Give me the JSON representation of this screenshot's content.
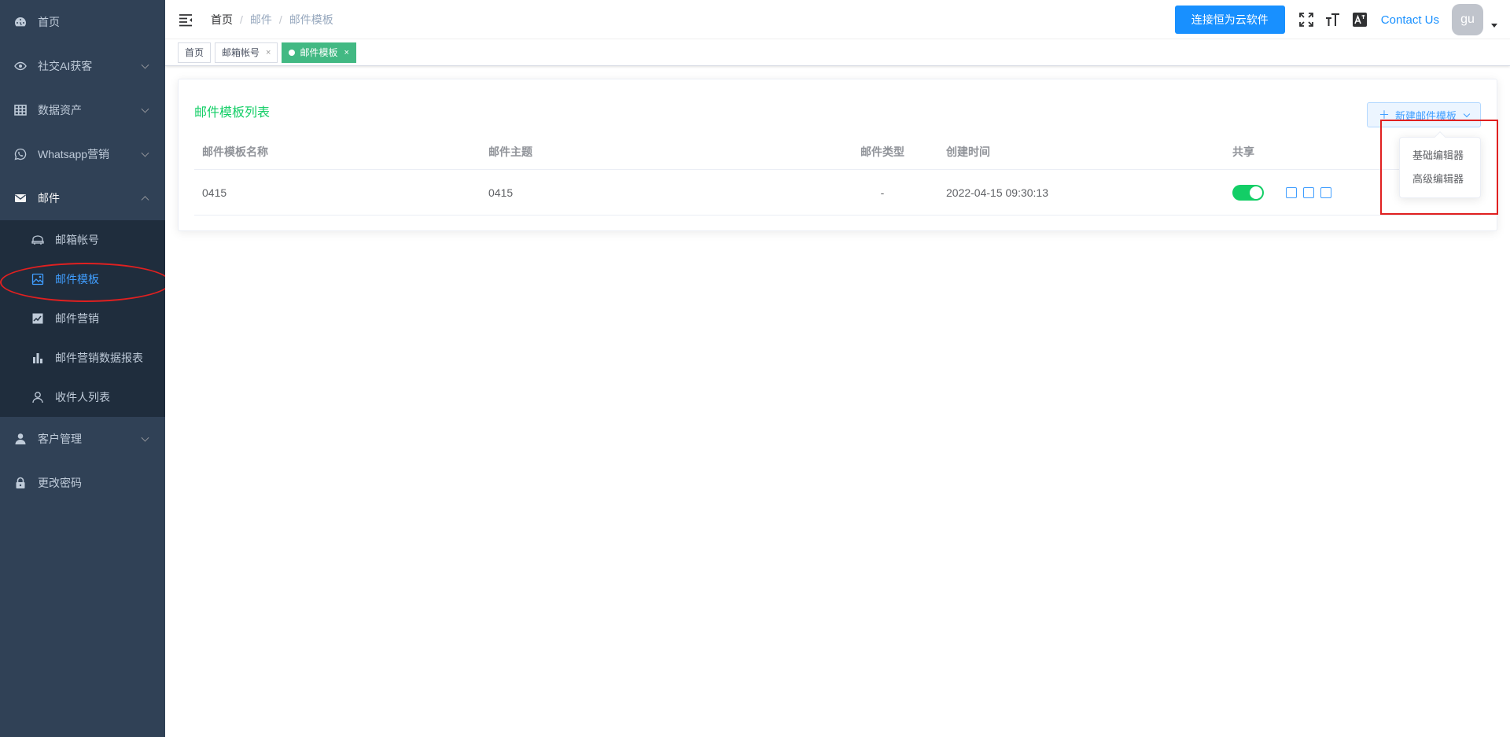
{
  "sidebar": {
    "items": [
      {
        "label": "首页",
        "icon": "dashboard-icon"
      },
      {
        "label": "社交AI获客",
        "icon": "eye-icon"
      },
      {
        "label": "数据资产",
        "icon": "grid-icon"
      },
      {
        "label": "Whatsapp营销",
        "icon": "whatsapp-icon"
      },
      {
        "label": "邮件",
        "icon": "mail-icon"
      },
      {
        "label": "客户管理",
        "icon": "user-icon"
      },
      {
        "label": "更改密码",
        "icon": "lock-icon"
      }
    ],
    "mail_submenu": [
      {
        "label": "邮箱帐号",
        "icon": "envelope-icon"
      },
      {
        "label": "邮件模板",
        "icon": "image-icon"
      },
      {
        "label": "邮件营销",
        "icon": "chart-icon"
      },
      {
        "label": "邮件营销数据报表",
        "icon": "bar-chart-icon"
      },
      {
        "label": "收件人列表",
        "icon": "person-icon"
      }
    ]
  },
  "navbar": {
    "breadcrumb": [
      "首页",
      "邮件",
      "邮件模板"
    ],
    "cloud_button": "连接恒为云软件",
    "contact": "Contact Us",
    "avatar_text": "gu"
  },
  "tags": [
    {
      "label": "首页",
      "closable": false
    },
    {
      "label": "邮箱帐号",
      "closable": true
    },
    {
      "label": "邮件模板",
      "closable": true,
      "active": true
    }
  ],
  "tag_close": "×",
  "card": {
    "title": "邮件模板列表",
    "create_button": "新建邮件模板",
    "columns": [
      "邮件模板名称",
      "邮件主题",
      "邮件类型",
      "创建时间",
      "共享"
    ],
    "rows": [
      {
        "name": "0415",
        "subject": "0415",
        "type": "-",
        "created": "2022-04-15 09:30:13",
        "shared": true
      }
    ]
  },
  "dropdown": {
    "items": [
      "基础编辑器",
      "高级编辑器"
    ]
  },
  "colors": {
    "sidebar_bg": "#304156",
    "submenu_bg": "#1f2d3d",
    "accent": "#409eff",
    "tag_active": "#42b983",
    "title_green": "#13ce66",
    "annotation_red": "#e02020"
  }
}
